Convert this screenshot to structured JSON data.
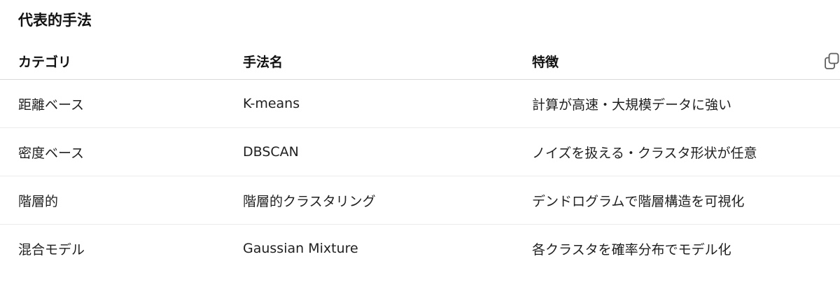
{
  "section": {
    "title": "代表的手法"
  },
  "table": {
    "headers": [
      "カテゴリ",
      "手法名",
      "特徴"
    ],
    "rows": [
      [
        "距離ベース",
        "K-means",
        "計算が高速・大規模データに強い"
      ],
      [
        "密度ベース",
        "DBSCAN",
        "ノイズを扱える・クラスタ形状が任意"
      ],
      [
        "階層的",
        "階層的クラスタリング",
        "デンドログラムで階層構造を可視化"
      ],
      [
        "混合モデル",
        "Gaussian Mixture",
        "各クラスタを確率分布でモデル化"
      ]
    ]
  },
  "icons": {
    "copy": "copy-icon"
  }
}
